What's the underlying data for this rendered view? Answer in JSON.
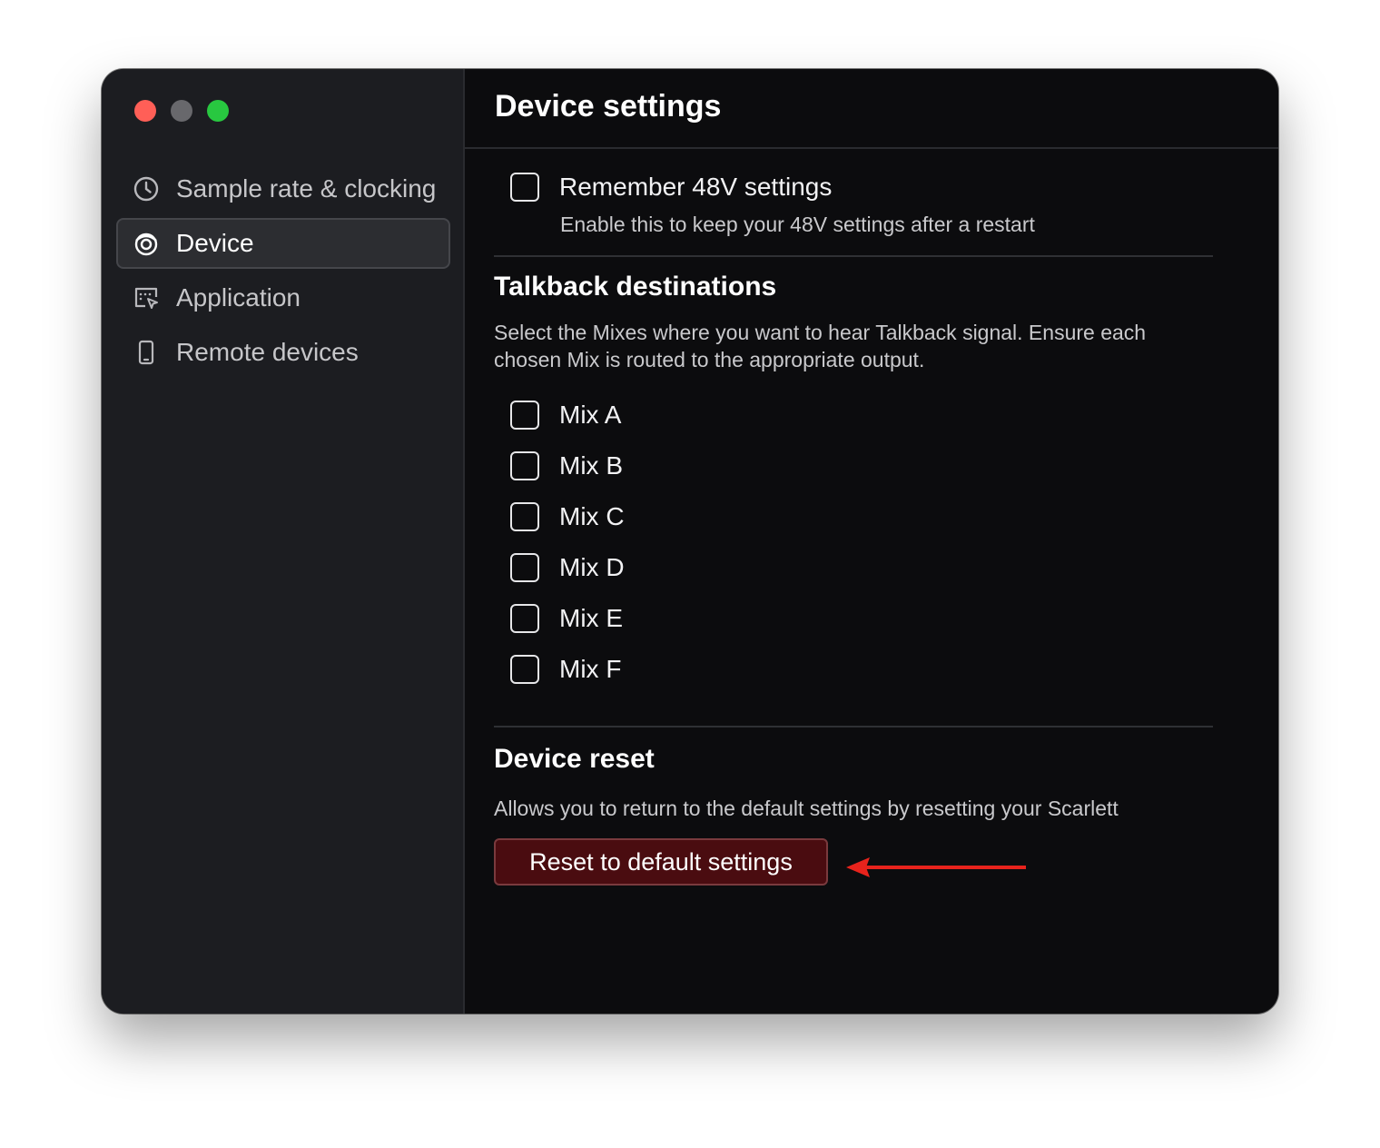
{
  "window": {
    "traffic_lights": [
      "close",
      "minimize",
      "zoom"
    ]
  },
  "sidebar": {
    "items": [
      {
        "label": "Sample rate & clocking",
        "icon": "clock-icon",
        "active": false
      },
      {
        "label": "Device",
        "icon": "device-icon",
        "active": true
      },
      {
        "label": "Application",
        "icon": "application-icon",
        "active": false
      },
      {
        "label": "Remote devices",
        "icon": "phone-icon",
        "active": false
      }
    ]
  },
  "main": {
    "title": "Device settings",
    "remember48v": {
      "label": "Remember 48V settings",
      "description": "Enable this to keep your 48V settings after a restart",
      "checked": false
    },
    "talkback": {
      "title": "Talkback destinations",
      "description": "Select the Mixes where you want to hear Talkback signal. Ensure each chosen Mix is routed to the appropriate output.",
      "mixes": [
        {
          "label": "Mix A",
          "checked": false
        },
        {
          "label": "Mix B",
          "checked": false
        },
        {
          "label": "Mix C",
          "checked": false
        },
        {
          "label": "Mix D",
          "checked": false
        },
        {
          "label": "Mix E",
          "checked": false
        },
        {
          "label": "Mix F",
          "checked": false
        }
      ]
    },
    "reset": {
      "title": "Device reset",
      "description": "Allows you to return to the default settings by resetting your Scarlett",
      "button_label": "Reset to default settings"
    }
  },
  "colors": {
    "sidebar_bg": "#1c1d21",
    "main_bg": "#0c0c0e",
    "reset_button_bg": "#4a0c10",
    "annotation_arrow": "#e8231c"
  }
}
